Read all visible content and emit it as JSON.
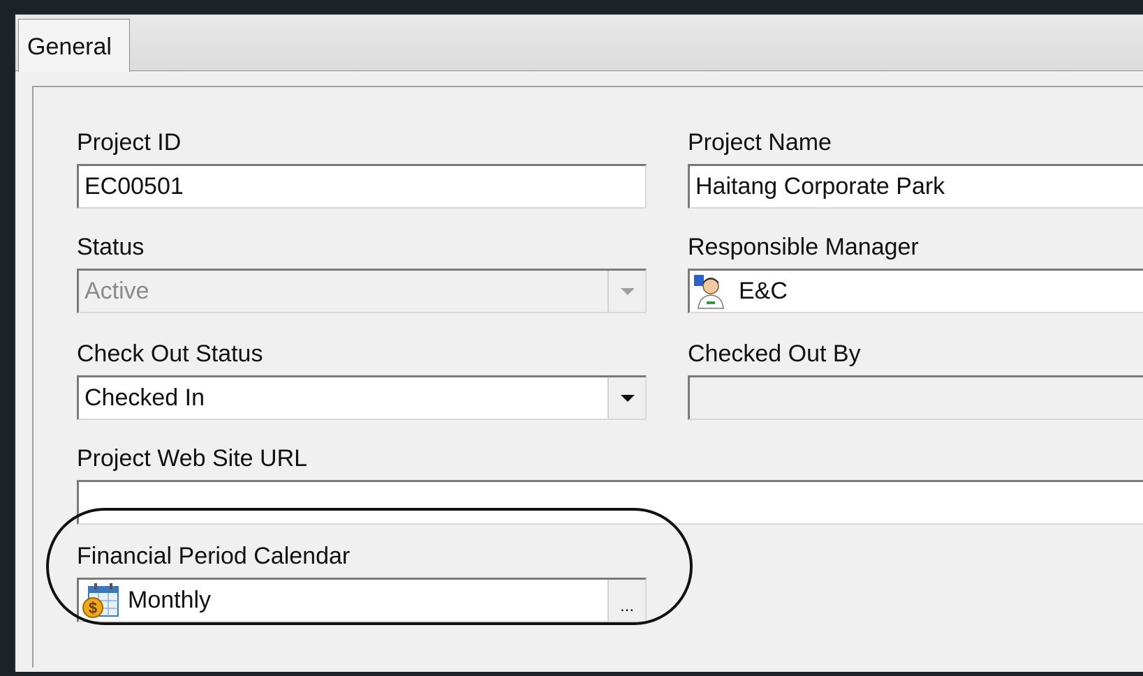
{
  "tabs": [
    {
      "label": "General"
    }
  ],
  "fields": {
    "project_id": {
      "label": "Project ID",
      "value": "EC00501"
    },
    "project_name": {
      "label": "Project Name",
      "value": "Haitang Corporate Park"
    },
    "status": {
      "label": "Status",
      "value": "Active"
    },
    "responsible_manager": {
      "label": "Responsible Manager",
      "value": "E&C"
    },
    "check_out_status": {
      "label": "Check Out Status",
      "value": "Checked In"
    },
    "checked_out_by": {
      "label": "Checked Out By",
      "value": ""
    },
    "web_site_url": {
      "label": "Project Web Site URL",
      "value": ""
    },
    "financial_period_calendar": {
      "label": "Financial Period Calendar",
      "value": "Monthly",
      "button_label": "..."
    }
  },
  "icons": {
    "manager": "user-icon",
    "calendar": "financial-calendar-icon"
  },
  "colors": {
    "window_bg": "#f0f0f0",
    "backdrop": "#1d2226",
    "highlight_oval": "#111111"
  }
}
